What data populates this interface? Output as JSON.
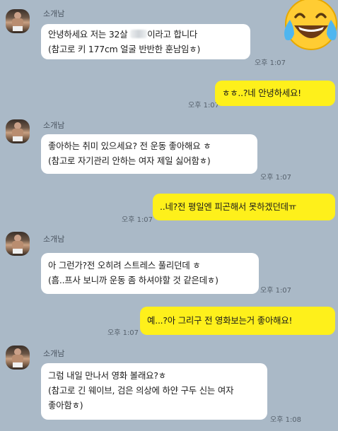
{
  "sender_name": "소개남",
  "messages": [
    {
      "dir": "in",
      "text": "안녕하세요 저는 32살  이라고 합니다\n(참고로 키 177cm 얼굴 반반한 훈남임ㅎ)",
      "time": "오후 1:07"
    },
    {
      "dir": "out",
      "text": "ㅎㅎ..?네 안녕하세요!",
      "time": "오후 1:07"
    },
    {
      "dir": "in",
      "text": "좋아하는 취미 있으세요? 전 운동 좋아해요 ㅎ\n(참고로 자기관리 안하는 여자 제일 싫어함ㅎ)",
      "time": "오후 1:07"
    },
    {
      "dir": "out",
      "text": "..네?전 평일엔 피곤해서 못하겠던데ㅠ",
      "time": "오후 1:07"
    },
    {
      "dir": "in",
      "text": "아 그런가?전 오히려 스트레스 풀리던데 ㅎ\n(흠..프사 보니까 운동 좀 하셔야할 것 같은데ㅎ)",
      "time": "오후 1:07"
    },
    {
      "dir": "out",
      "text": "예...?아 그리구 전 영화보는거 좋아해요!",
      "time": "오후 1:07"
    },
    {
      "dir": "in",
      "text": "그럼 내일 만나서 영화 볼래요?ㅎ\n(참고로 긴 웨이브, 검은 의상에 하얀 구두 신는 여자\n좋아함ㅎ)",
      "time": "오후 1:08"
    }
  ],
  "first_message_parts": {
    "before": "안녕하세요 저는 32살 ",
    "after": "이라고 합니다",
    "line2": "(참고로 키 177cm 얼굴 반반한 훈남임ㅎ)"
  },
  "emoji": "laughing-with-tears-emoji",
  "colors": {
    "background": "#aab9c7",
    "incoming_bubble": "#ffffff",
    "outgoing_bubble": "#fef01b"
  }
}
